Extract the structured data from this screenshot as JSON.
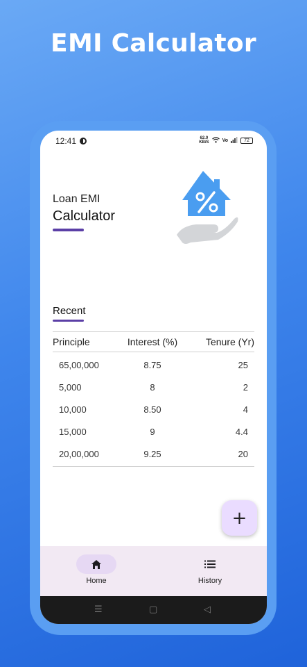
{
  "promo": {
    "title": "EMI Calculator"
  },
  "status_bar": {
    "time": "12:41",
    "net_speed_value": "62.0",
    "net_speed_unit": "KB/S",
    "battery": "72",
    "icons": [
      "wifi-icon",
      "volte-icon",
      "signal-icon",
      "battery-icon"
    ]
  },
  "hero": {
    "line1": "Loan EMI",
    "line2": "Calculator"
  },
  "recent": {
    "heading": "Recent",
    "columns": [
      "Principle",
      "Interest (%)",
      "Tenure (Yr)"
    ],
    "rows": [
      [
        "65,00,000",
        "8.75",
        "25"
      ],
      [
        "5,000",
        "8",
        "2"
      ],
      [
        "10,000",
        "8.50",
        "4"
      ],
      [
        "15,000",
        "9",
        "4.4"
      ],
      [
        "20,00,000",
        "9.25",
        "20"
      ]
    ]
  },
  "fab": {
    "label": "+"
  },
  "nav": {
    "home": "Home",
    "history": "History"
  },
  "colors": {
    "accent": "#5b3fa6",
    "fab_bg": "#eadcff",
    "nav_bg": "#f2e9f3",
    "illustration": "#4a9df0"
  }
}
